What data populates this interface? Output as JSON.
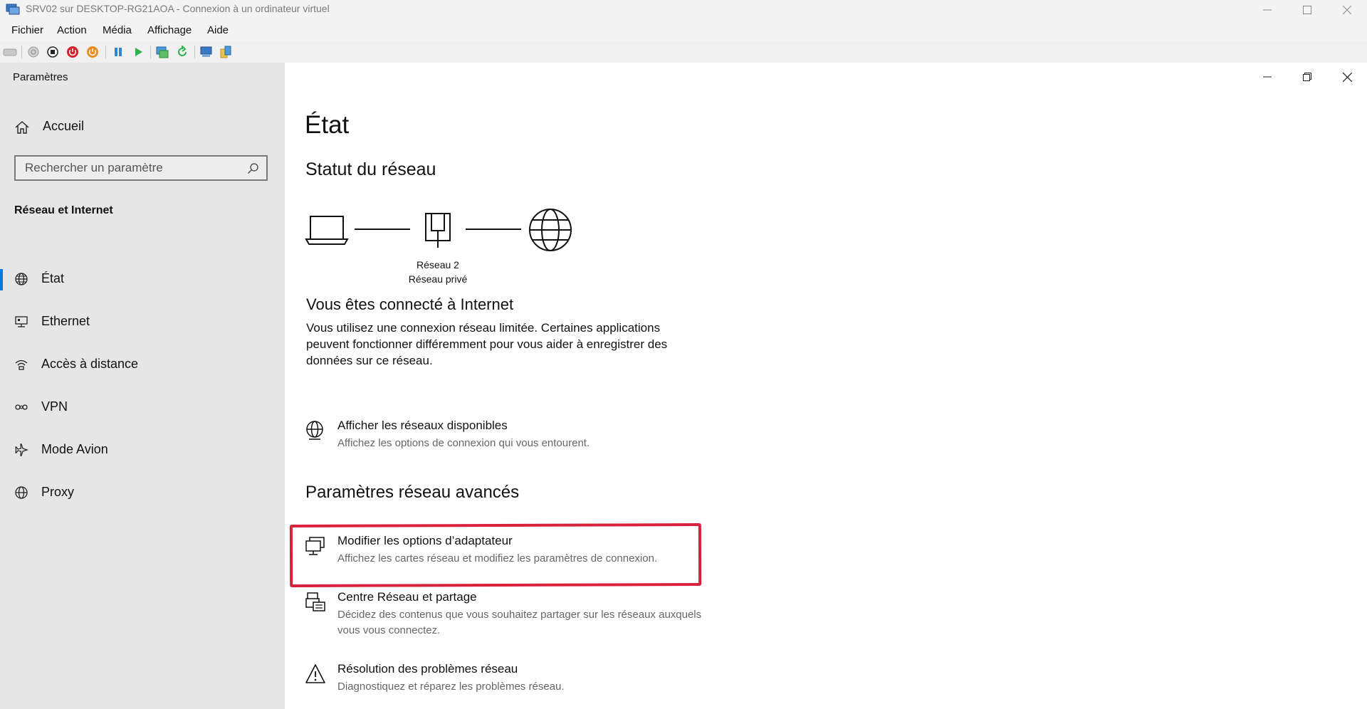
{
  "vm_window": {
    "title": "SRV02 sur DESKTOP-RG21AOA - Connexion à un ordinateur virtuel",
    "menu": [
      "Fichier",
      "Action",
      "Média",
      "Affichage",
      "Aide"
    ],
    "toolbar_icons": [
      "ctrl-alt-del-icon",
      "start-icon",
      "turn-off-icon",
      "shutdown-icon",
      "save-icon",
      "pause-icon",
      "resume-icon",
      "checkpoint-icon",
      "revert-icon",
      "enhanced-session-icon",
      "share-icon"
    ]
  },
  "settings": {
    "app_title": "Paramètres",
    "home_label": "Accueil",
    "search": {
      "placeholder": "Rechercher un paramètre",
      "value": ""
    },
    "section_heading": "Réseau et Internet",
    "nav_items": [
      {
        "label": "État",
        "icon": "globe-icon",
        "selected": true
      },
      {
        "label": "Ethernet",
        "icon": "ethernet-icon",
        "selected": false
      },
      {
        "label": "Accès à distance",
        "icon": "dialup-icon",
        "selected": false
      },
      {
        "label": "VPN",
        "icon": "vpn-icon",
        "selected": false
      },
      {
        "label": "Mode Avion",
        "icon": "airplane-icon",
        "selected": false
      },
      {
        "label": "Proxy",
        "icon": "globe-icon",
        "selected": false
      }
    ],
    "accent_color": "#0078d7"
  },
  "main": {
    "page_title": "État",
    "network_status_heading": "Statut du réseau",
    "network_name": "Réseau 2",
    "network_type": "Réseau privé",
    "connected_title": "Vous êtes connecté à Internet",
    "connected_desc": "Vous utilisez une connexion réseau limitée. Certaines applications peuvent fonctionner différemment pour vous aider à enregistrer des données sur ce réseau.",
    "show_networks": {
      "title": "Afficher les réseaux disponibles",
      "desc": "Affichez les options de connexion qui vous entourent."
    },
    "advanced_heading": "Paramètres réseau avancés",
    "advanced_items": [
      {
        "title": "Modifier les options d’adaptateur",
        "desc": "Affichez les cartes réseau et modifiez les paramètres de connexion.",
        "highlighted": true
      },
      {
        "title": "Centre Réseau et partage",
        "desc": "Décidez des contenus que vous souhaitez partager sur les réseaux auxquels vous vous connectez.",
        "highlighted": false
      },
      {
        "title": "Résolution des problèmes réseau",
        "desc": "Diagnostiquez et réparez les problèmes réseau.",
        "highlighted": false
      }
    ],
    "highlight_color": "#d8213b"
  }
}
